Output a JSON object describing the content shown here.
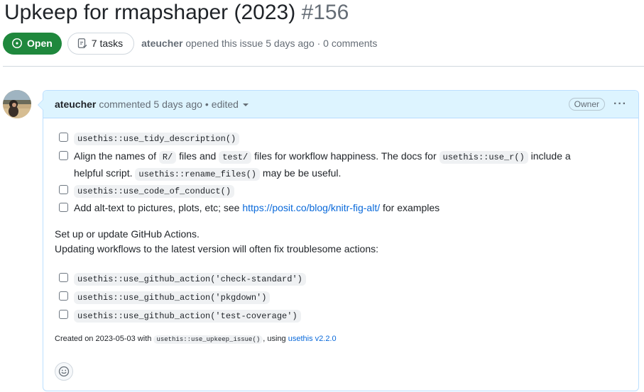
{
  "issue": {
    "title": "Upkeep for rmapshaper (2023)",
    "number": "#156",
    "state": "Open",
    "tasks_label": "7 tasks",
    "author": "ateucher",
    "meta_rest": "opened this issue 5 days ago · 0 comments"
  },
  "comment": {
    "author": "ateucher",
    "action": "commented 5 days ago",
    "separator": "•",
    "edited": "edited",
    "badge": "Owner",
    "menu": "···"
  },
  "tasks": {
    "t1": "usethis::use_tidy_description()",
    "t2_a": "Align the names of ",
    "t2_code1": "R/",
    "t2_b": " files and ",
    "t2_code2": "test/",
    "t2_c": " files for workflow happiness. The docs for ",
    "t2_code3": "usethis::use_r()",
    "t2_d": " include a",
    "t2_e": "helpful script. ",
    "t2_code4": "usethis::rename_files()",
    "t2_f": " may be be useful.",
    "t3": "usethis::use_code_of_conduct()",
    "t4_a": "Add alt-text to pictures, plots, etc; see ",
    "t4_link": "https://posit.co/blog/knitr-fig-alt/",
    "t4_b": " for examples",
    "t5": "usethis::use_github_action('check-standard')",
    "t6": "usethis::use_github_action('pkgdown')",
    "t7": "usethis::use_github_action('test-coverage')"
  },
  "paragraph": {
    "line1": "Set up or update GitHub Actions.",
    "line2": "Updating workflows to the latest version will often fix troublesome actions:"
  },
  "footer": {
    "a": "Created on 2023-05-03 with ",
    "code": "usethis::use_upkeep_issue()",
    "b": ", using ",
    "link": "usethis v2.2.0"
  },
  "colors": {
    "open_green": "#1f883d",
    "link_blue": "#0969da",
    "header_bg": "#ddf4ff"
  }
}
